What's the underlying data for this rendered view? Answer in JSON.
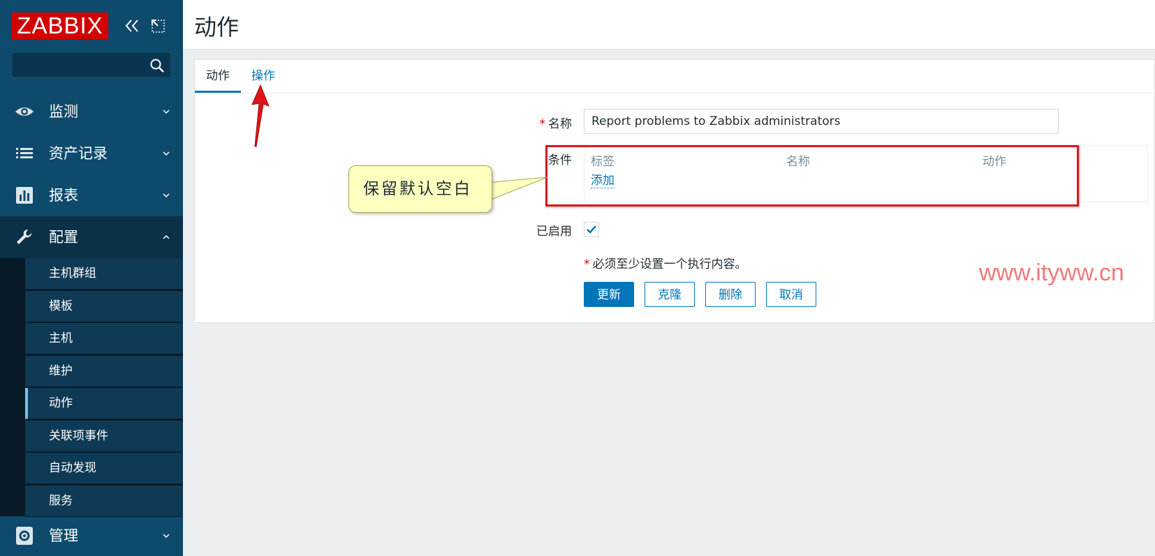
{
  "sidebar": {
    "logo": "ZABBIX",
    "search": {
      "value": "",
      "placeholder": ""
    },
    "menu": [
      {
        "label": "监测",
        "icon": "eye-icon"
      },
      {
        "label": "资产记录",
        "icon": "list-icon"
      },
      {
        "label": "报表",
        "icon": "bar-chart-icon"
      },
      {
        "label": "配置",
        "icon": "wrench-icon"
      },
      {
        "label": "管理",
        "icon": "gear-icon"
      }
    ],
    "submenu": [
      "主机群组",
      "模板",
      "主机",
      "维护",
      "动作",
      "关联项事件",
      "自动发现",
      "服务"
    ]
  },
  "header": {
    "title": "动作"
  },
  "tabs": [
    "动作",
    "操作"
  ],
  "form": {
    "name_label": "名称",
    "name_value": "Report problems to Zabbix administrators",
    "conditions_label": "条件",
    "conditions_columns": [
      "标签",
      "名称",
      "动作"
    ],
    "add_label": "添加",
    "enabled_label": "已启用",
    "enabled": true,
    "hint": "必须至少设置一个执行内容。",
    "required_mark": "*"
  },
  "buttons": [
    "更新",
    "克隆",
    "删除",
    "取消"
  ],
  "annotations": {
    "callout": "保留默认空白",
    "watermark": "www.ityww.cn"
  },
  "colors": {
    "sidebar": "#0e4a6b",
    "accent": "#0275b8",
    "logo": "#d40000",
    "annotation_red": "#e0141b"
  }
}
